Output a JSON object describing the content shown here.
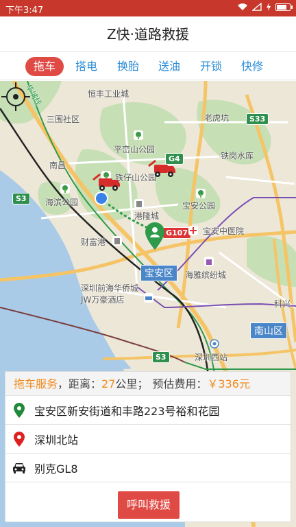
{
  "status": {
    "time": "下午3:47",
    "battery_level": 0.85
  },
  "header": {
    "title": "Z快·道路救援"
  },
  "tabs": [
    {
      "label": "拖车",
      "active": true
    },
    {
      "label": "搭电",
      "active": false
    },
    {
      "label": "换胎",
      "active": false
    },
    {
      "label": "送油",
      "active": false
    },
    {
      "label": "开锁",
      "active": false
    },
    {
      "label": "快修",
      "active": false
    }
  ],
  "map": {
    "places": [
      "恒丰工业城",
      "三围社区",
      "老虎坑",
      "平峦山公园",
      "铁岗水库",
      "南昌",
      "铁仔山公园",
      "海滨公园",
      "宝安公园",
      "港隆城",
      "宝安中医院",
      "财富港",
      "海雅缤纷城",
      "深圳前海华侨城JW万豪酒店",
      "科兴",
      "深圳西站"
    ],
    "road_badges": {
      "s33": "S33",
      "g4": "G4",
      "s3_left": "S3",
      "g107": "G107",
      "s3_bottom": "S3"
    },
    "district_badges": {
      "baoan": "宝安区",
      "nanshan": "南山区"
    },
    "line_label": "华埔线",
    "colors": {
      "accent": "#e04a44",
      "link": "#2a8bd6",
      "price": "#f08a1c",
      "route": "#2e9a4a"
    }
  },
  "info": {
    "service": "拖车服务",
    "distance_label": "，距离：",
    "distance_value": "27",
    "distance_unit": "公里；",
    "fee_label": "预估费用：",
    "fee_value": "￥336元",
    "origin": "宝安区新安街道和丰路223号裕和花园",
    "destination": "深圳北站",
    "vehicle": "别克GL8",
    "call_button": "呼叫救援"
  }
}
